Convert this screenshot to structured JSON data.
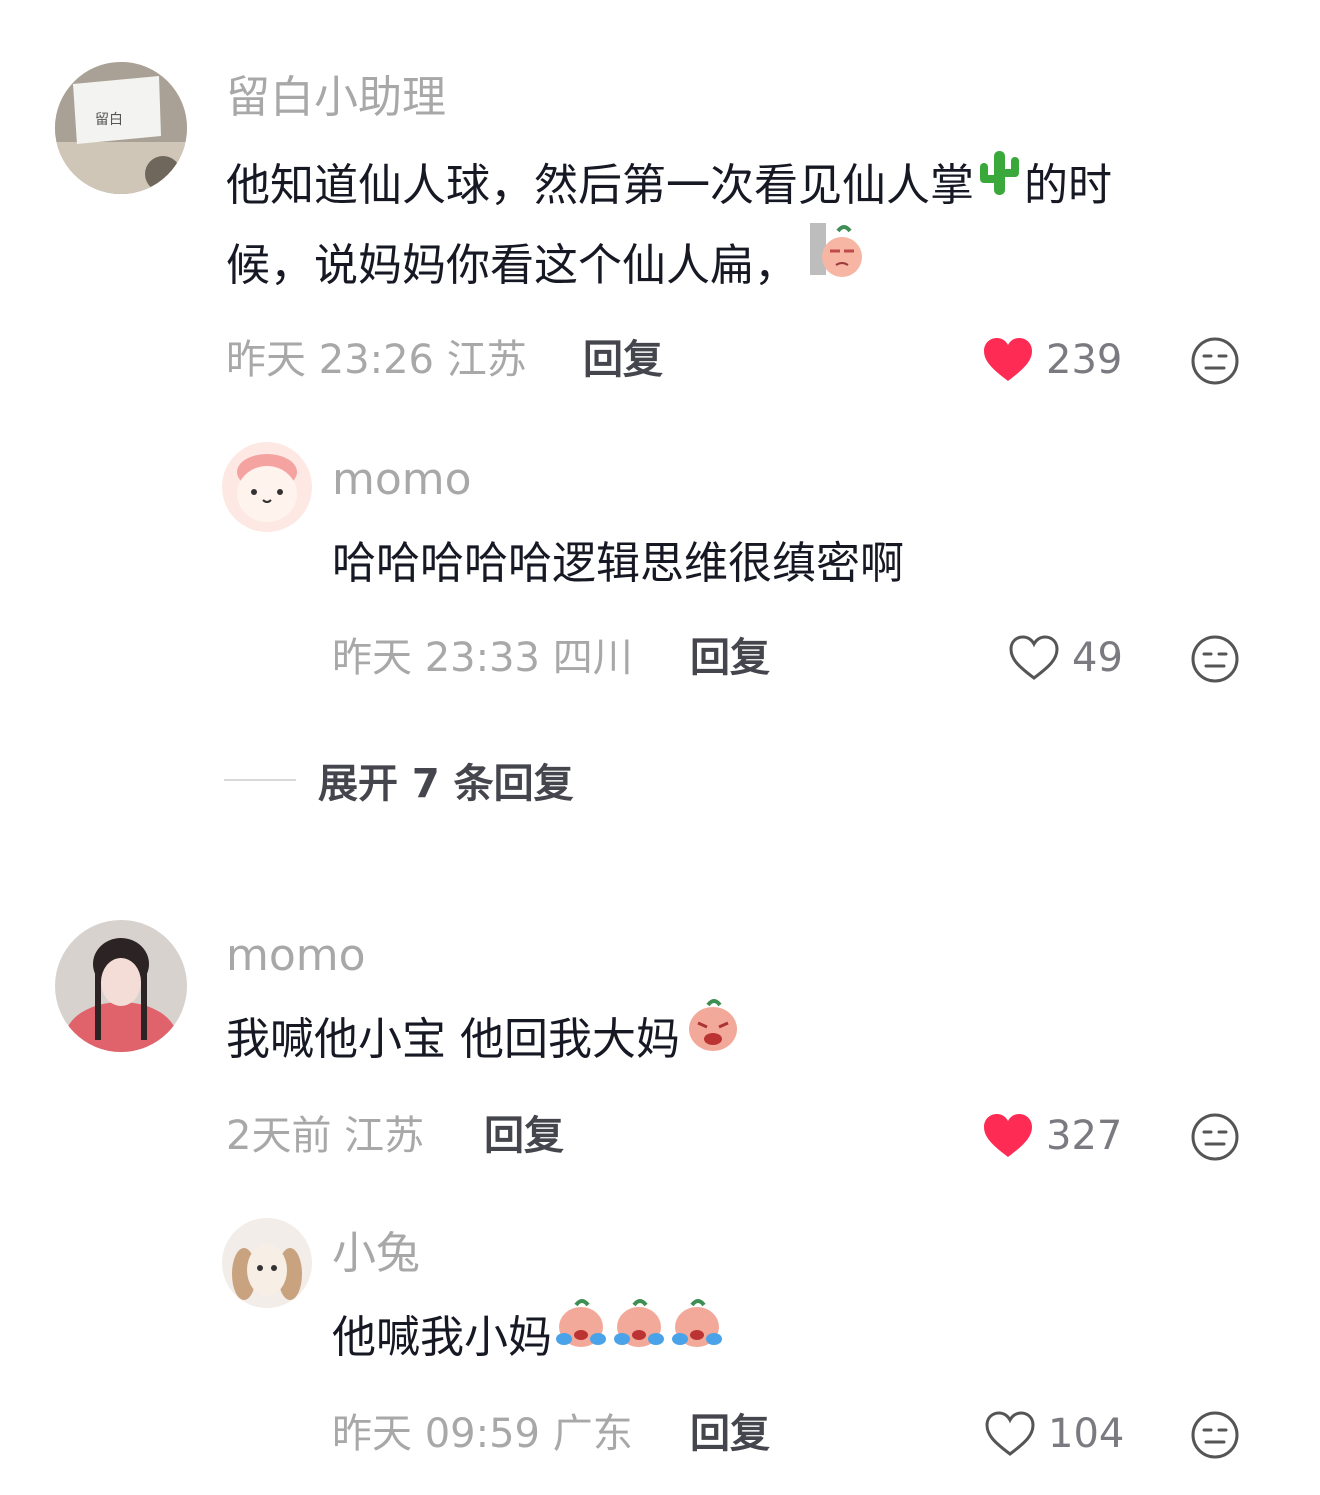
{
  "comments": [
    {
      "username": "留白小助理",
      "avatar_text": "留白",
      "content_line1_a": "他知道仙人球，然后第一次看见仙人掌",
      "content_line1_b": "的时",
      "content_line2": "候，说妈妈你看这个仙人扁，",
      "meta": "昨天 23:26 江苏",
      "reply_label": "回复",
      "likes": "239",
      "liked": true,
      "replies": [
        {
          "username": "momo",
          "content": "哈哈哈哈哈逻辑思维很缜密啊",
          "meta": "昨天 23:33 四川",
          "reply_label": "回复",
          "likes": "49",
          "liked": false
        }
      ],
      "expand_label": "展开 7 条回复"
    },
    {
      "username": "momo",
      "content": "我喊他小宝 他回我大妈",
      "meta": "2天前 江苏",
      "reply_label": "回复",
      "likes": "327",
      "liked": true,
      "replies": [
        {
          "username": "小兔",
          "content": "他喊我小妈",
          "meta": "昨天 09:59 广东",
          "reply_label": "回复",
          "likes": "104",
          "liked": false
        }
      ]
    }
  ],
  "colors": {
    "like_active": "#fe2c55",
    "username": "#a8a8a8",
    "text": "#161823",
    "meta": "#a8a8a8"
  }
}
